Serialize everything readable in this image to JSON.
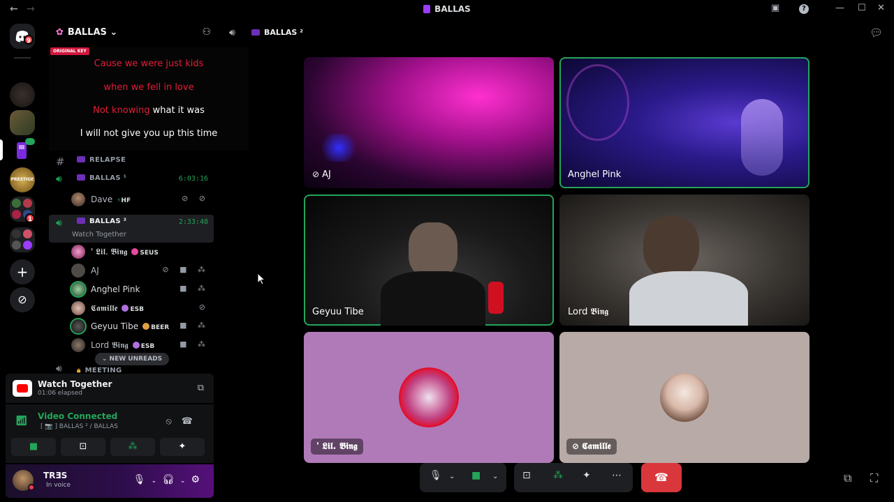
{
  "window": {
    "title": "BALLAS",
    "back_icon": "←",
    "forward_icon": "→",
    "inbox_icon": "▣",
    "help_icon": "?",
    "minimize": "—",
    "maximize": "☐",
    "close": "✕"
  },
  "rail": {
    "dm_badge": "9",
    "server_badge": "1",
    "add_icon": "+",
    "discover_icon": "⊘"
  },
  "server": {
    "name": "BALLAS",
    "chevron": "⌄",
    "invite_icon": "⚇"
  },
  "lyrics": {
    "tag": "ORIGINAL KEY",
    "line1": "Cause we were just kids",
    "line2": "when we fell in love",
    "line3_red": "Not knowing",
    "line3_white": " what it was",
    "line4": "I will not give you up this time"
  },
  "channels": [
    {
      "name": "RELAPSE",
      "type": "text"
    },
    {
      "name": "BALLAS ¹",
      "type": "voice",
      "timer": "6:03:16"
    },
    {
      "name": "BALLAS ²",
      "type": "voice",
      "timer": "2:33:48",
      "activity": "Watch Together"
    },
    {
      "name": "MEETING",
      "type": "voice"
    }
  ],
  "voice_users": {
    "ballas1": [
      {
        "name": "Dave",
        "tag": "HF",
        "icons": "⊘ ⊘"
      }
    ],
    "ballas2": [
      {
        "name": "' 𝕷𝖎𝖑. 𝕭𝖎𝖓𝖌",
        "tag": "SEUS",
        "icons": ""
      },
      {
        "name": "AJ",
        "tag": "",
        "icons": "⊘ ■ ⁂"
      },
      {
        "name": "Anghel Pink",
        "tag": "",
        "icons": "■ ⁂"
      },
      {
        "name": "𝕮𝖆𝖒𝖎𝖑𝖑𝖊",
        "tag": "ESB",
        "icons": "⊘"
      },
      {
        "name": "Geyuu Tibe",
        "tag": "BEER",
        "icons": "■ ⁂"
      },
      {
        "name": "Lord 𝕭𝖎𝖓𝖌",
        "tag": "ESB",
        "icons": "■ ⁂"
      }
    ]
  },
  "new_unreads": "NEW UNREADS",
  "activity_panel": {
    "title": "Watch Together",
    "elapsed": "01:06 elapsed"
  },
  "connection": {
    "status": "Video Connected",
    "location": "[ 📷 ] BALLAS ² / BALLAS"
  },
  "user": {
    "name": "TRƎS",
    "status": "In voice"
  },
  "voice_header": {
    "channel": "BALLAS ²"
  },
  "tiles": [
    {
      "name": "AJ",
      "muted": true,
      "speaking": false
    },
    {
      "name": "Anghel Pink",
      "muted": false,
      "speaking": true
    },
    {
      "name": "Geyuu Tibe",
      "muted": false,
      "speaking": true
    },
    {
      "name": "Lord 𝕭𝖎𝖓𝖌",
      "muted": false,
      "speaking": false
    },
    {
      "name": "' 𝕷𝖎𝖑. 𝕭𝖎𝖓𝖌",
      "muted": false,
      "speaking": false
    },
    {
      "name": "𝕮𝖆𝖒𝖎𝖑𝖑𝖊",
      "muted": true,
      "speaking": false
    }
  ],
  "controls": {
    "mic_icon": "🎙",
    "more_icon": "⋯",
    "hangup_icon": "☎"
  },
  "colors": {
    "accent_green": "#23a55a",
    "hangup_red": "#da373c",
    "lyric_red": "#e11d38",
    "mention_red": "#f23f43"
  }
}
